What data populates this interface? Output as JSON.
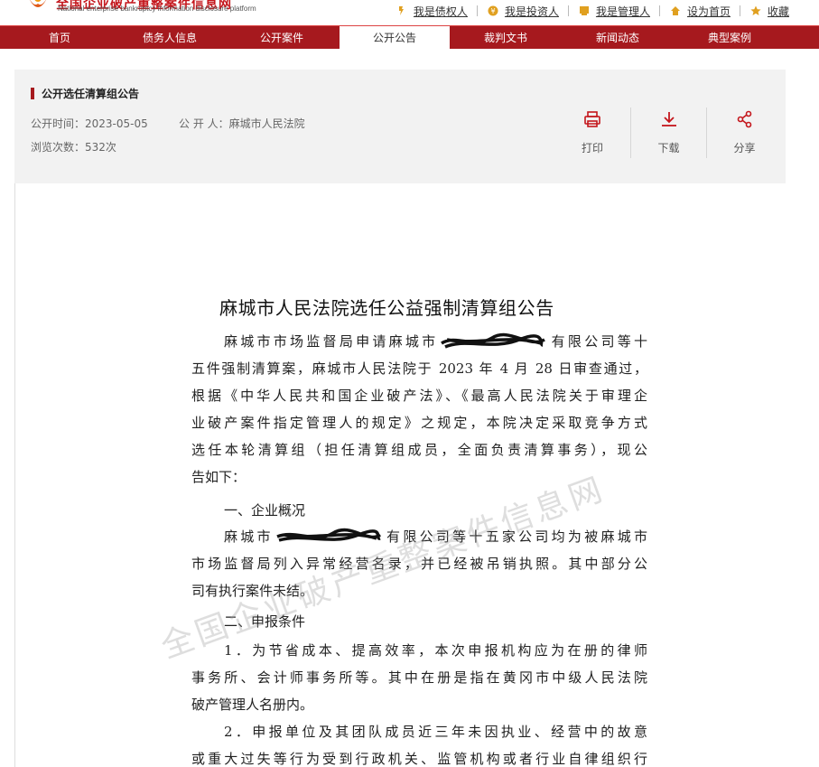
{
  "header": {
    "logo_cn": "全国企业破产重整案件信息网",
    "logo_en": "National enterprise bankruptcy information disclosure platform",
    "links": [
      {
        "label": "我是债权人",
        "icon": "creditor-icon"
      },
      {
        "label": "我是投资人",
        "icon": "investor-icon"
      },
      {
        "label": "我是管理人",
        "icon": "administrator-icon"
      },
      {
        "label": "设为首页",
        "icon": "home-icon"
      },
      {
        "label": "收藏",
        "icon": "star-icon"
      }
    ]
  },
  "nav": {
    "items": [
      "首页",
      "债务人信息",
      "公开案件",
      "公开公告",
      "裁判文书",
      "新闻动态",
      "典型案例"
    ],
    "active_index": 3
  },
  "notice": {
    "title": "公开选任清算组公告",
    "publish_time_label": "公开时间：",
    "publish_time": "2023-05-05",
    "publisher_label": "公 开 人：",
    "publisher": "麻城市人民法院",
    "views_label": "浏览次数：",
    "views": "532次",
    "actions": [
      {
        "label": "打印",
        "icon": "print-icon"
      },
      {
        "label": "下载",
        "icon": "download-icon"
      },
      {
        "label": "分享",
        "icon": "share-icon"
      }
    ]
  },
  "document": {
    "title": "麻城市人民法院选任公益强制清算组公告",
    "p1": [
      "麻城市市场监督局申请麻城市",
      "有限公司等十",
      "五件强制清算案，麻城市人民法院于 2023 年 4 月 28 日审查通过，",
      "根据《中华人民共和国企业破产法》、《最高人民法院关于审理企",
      "业破产案件指定管理人的规定》之规定，本院决定采取竞争方式",
      "选任本轮清算组（担任清算组成员，全面负责清算事务），现公",
      "告如下："
    ],
    "h1": "一、企业概况",
    "p2": [
      "麻城市",
      "有限公司等十五家公司均为被麻城市",
      "市场监督局列入异常经营名录，并已经被吊销执照。其中部分公",
      "司有执行案件未结。"
    ],
    "h2": "二、申报条件",
    "p3": [
      "1．为节省成本、提高效率，本次申报机构应为在册的律师",
      "事务所、会计师事务所等。其中在册是指在黄冈市中级人民法院",
      "破产管理人名册内。"
    ],
    "p4": [
      "2．申报单位及其团队成员近三年未因执业、经营中的故意",
      "或重大过失等行为受到行政机关、监管机构或者行业自律组织行"
    ]
  },
  "watermark": "全国企业破产重整案件信息网"
}
